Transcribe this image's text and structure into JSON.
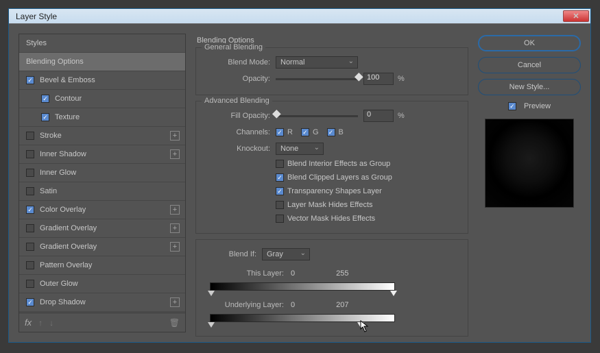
{
  "dialog": {
    "title": "Layer Style"
  },
  "styles": {
    "header": "Styles",
    "items": [
      {
        "label": "Blending Options",
        "checked": null,
        "selected": true,
        "add": false,
        "indent": false
      },
      {
        "label": "Bevel & Emboss",
        "checked": true,
        "selected": false,
        "add": false,
        "indent": false
      },
      {
        "label": "Contour",
        "checked": true,
        "selected": false,
        "add": false,
        "indent": true
      },
      {
        "label": "Texture",
        "checked": true,
        "selected": false,
        "add": false,
        "indent": true
      },
      {
        "label": "Stroke",
        "checked": false,
        "selected": false,
        "add": true,
        "indent": false
      },
      {
        "label": "Inner Shadow",
        "checked": false,
        "selected": false,
        "add": true,
        "indent": false
      },
      {
        "label": "Inner Glow",
        "checked": false,
        "selected": false,
        "add": false,
        "indent": false
      },
      {
        "label": "Satin",
        "checked": false,
        "selected": false,
        "add": false,
        "indent": false
      },
      {
        "label": "Color Overlay",
        "checked": true,
        "selected": false,
        "add": true,
        "indent": false
      },
      {
        "label": "Gradient Overlay",
        "checked": false,
        "selected": false,
        "add": true,
        "indent": false
      },
      {
        "label": "Gradient Overlay",
        "checked": false,
        "selected": false,
        "add": true,
        "indent": false
      },
      {
        "label": "Pattern Overlay",
        "checked": false,
        "selected": false,
        "add": false,
        "indent": false
      },
      {
        "label": "Outer Glow",
        "checked": false,
        "selected": false,
        "add": false,
        "indent": false
      },
      {
        "label": "Drop Shadow",
        "checked": true,
        "selected": false,
        "add": true,
        "indent": false
      }
    ],
    "footer": {
      "fx": "fx"
    }
  },
  "blending": {
    "section_title": "Blending Options",
    "general": {
      "legend": "General Blending",
      "blend_mode_label": "Blend Mode:",
      "blend_mode_value": "Normal",
      "opacity_label": "Opacity:",
      "opacity_value": "100",
      "opacity_unit": "%"
    },
    "advanced": {
      "legend": "Advanced Blending",
      "fill_opacity_label": "Fill Opacity:",
      "fill_opacity_value": "0",
      "fill_opacity_unit": "%",
      "channels_label": "Channels:",
      "channels": {
        "r": "R",
        "g": "G",
        "b": "B"
      },
      "knockout_label": "Knockout:",
      "knockout_value": "None",
      "checks": [
        {
          "label": "Blend Interior Effects as Group",
          "on": false
        },
        {
          "label": "Blend Clipped Layers as Group",
          "on": true
        },
        {
          "label": "Transparency Shapes Layer",
          "on": true
        },
        {
          "label": "Layer Mask Hides Effects",
          "on": false
        },
        {
          "label": "Vector Mask Hides Effects",
          "on": false
        }
      ]
    },
    "blend_if": {
      "label": "Blend If:",
      "value": "Gray",
      "this_layer": {
        "label": "This Layer:",
        "low": "0",
        "high": "255"
      },
      "underlying": {
        "label": "Underlying Layer:",
        "low": "0",
        "high": "207"
      }
    }
  },
  "buttons": {
    "ok": "OK",
    "cancel": "Cancel",
    "new_style": "New Style...",
    "preview": "Preview"
  }
}
